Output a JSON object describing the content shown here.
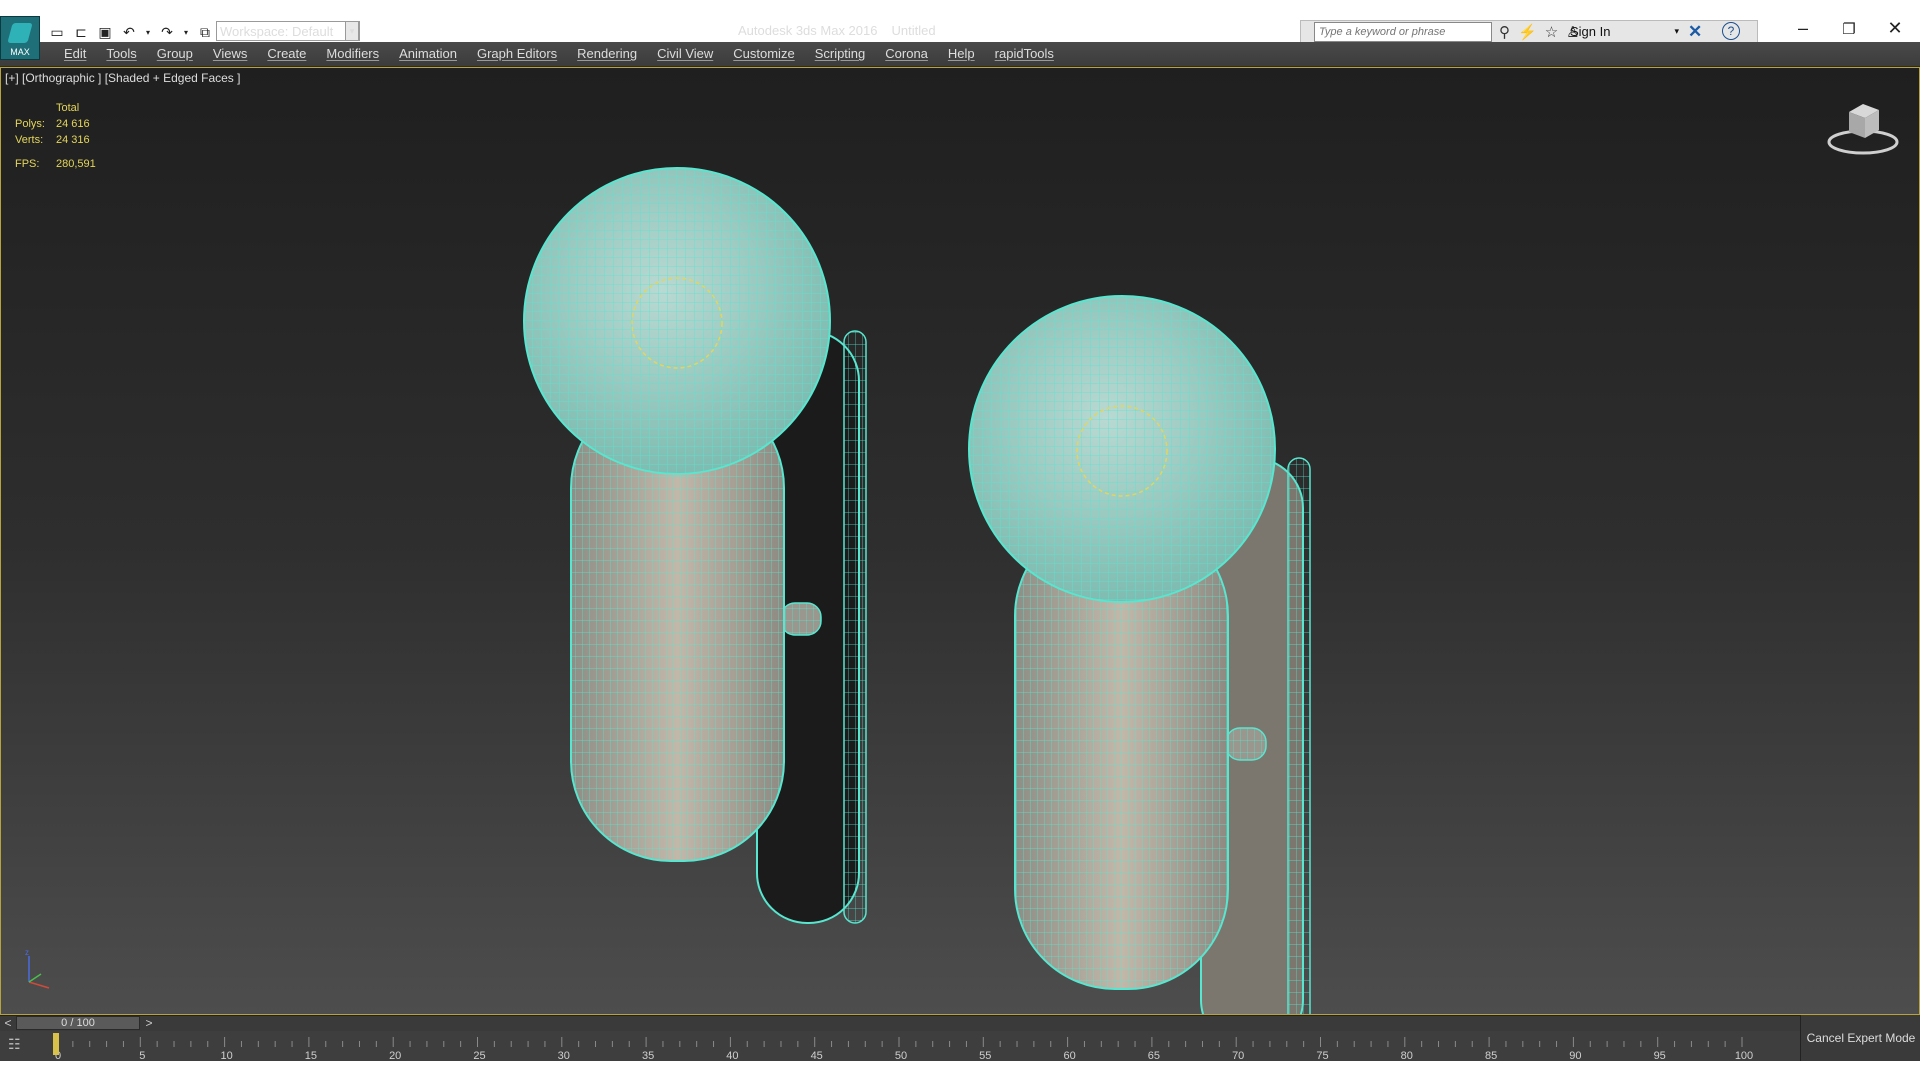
{
  "app": {
    "logo_label": "MAX",
    "workspace": "Workspace: Default",
    "title": "Autodesk 3ds Max 2016",
    "document": "Untitled",
    "search_placeholder": "Type a keyword or phrase",
    "sign_in": "Sign In"
  },
  "menu": [
    "Edit",
    "Tools",
    "Group",
    "Views",
    "Create",
    "Modifiers",
    "Animation",
    "Graph Editors",
    "Rendering",
    "Civil View",
    "Customize",
    "Scripting",
    "Corona",
    "Help",
    "rapidTools"
  ],
  "viewport": {
    "label": "[+] [Orthographic ] [Shaded + Edged Faces ]",
    "stats": {
      "total_label": "Total",
      "polys_label": "Polys:",
      "polys": "24 616",
      "verts_label": "Verts:",
      "verts": "24 316",
      "fps_label": "FPS:",
      "fps": "280,591"
    },
    "axis": {
      "z": "z"
    }
  },
  "timeline": {
    "frame": "0 / 100",
    "prev": "<",
    "next": ">",
    "ticks": [
      "0",
      "5",
      "10",
      "15",
      "20",
      "25",
      "30",
      "35",
      "40",
      "45",
      "50",
      "55",
      "60",
      "65",
      "70",
      "75",
      "80",
      "85",
      "90",
      "95",
      "100"
    ],
    "cancel_expert": "Cancel Expert Mode"
  },
  "colors": {
    "wire": "#57e6cf",
    "stats": "#e4d55a",
    "frame_accent": "#b8a23a"
  }
}
